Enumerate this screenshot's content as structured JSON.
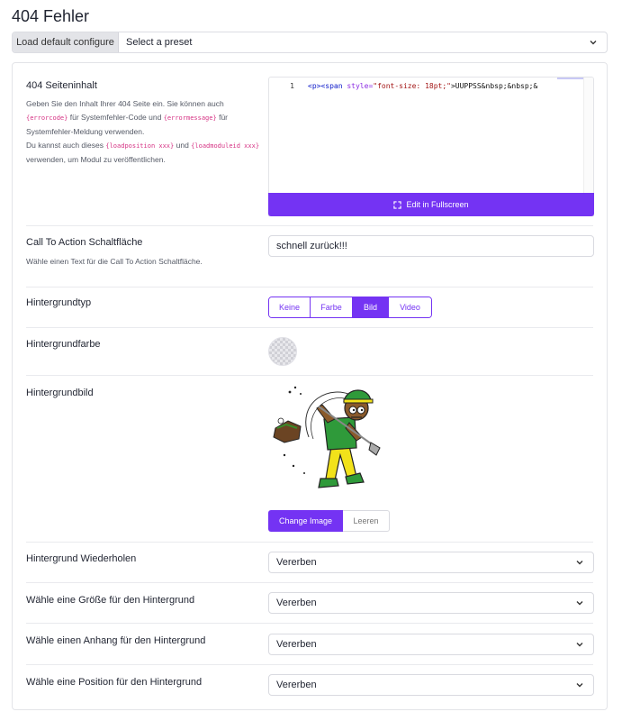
{
  "page": {
    "title": "404 Fehler"
  },
  "preset": {
    "load_default_label": "Load default configure",
    "select_placeholder": "Select a preset"
  },
  "content": {
    "label": "404 Seiteninhalt",
    "help_1": "Geben Sie den Inhalt Ihrer 404 Seite ein. Sie können auch",
    "token_errorcode": "{errorcode}",
    "help_2": "für Systemfehler-Code und",
    "token_errormessage": "{errormessage}",
    "help_3": "für Systemfehler-Meldung verwenden.",
    "help_4": "Du kannst auch dieses",
    "token_loadposition": "{loadposition xxx}",
    "help_5": "und",
    "token_loadmoduleid": "{loadmoduleid xxx}",
    "help_6": "verwenden, um Modul zu veröffentlichen.",
    "editor_line_number": "1",
    "editor_tag_open": "<p><span ",
    "editor_attr": "style=",
    "editor_str": "\"font-size: 18pt;\"",
    "editor_rest": ">UUPPSS&nbsp;&nbsp;&",
    "fullscreen_label": "Edit in Fullscreen"
  },
  "cta": {
    "label": "Call To Action Schaltfläche",
    "help": "Wähle einen Text für die Call To Action Schaltfläche.",
    "value": "schnell zurück!!!"
  },
  "bg_type": {
    "label": "Hintergrundtyp",
    "options": [
      "Keine",
      "Farbe",
      "Bild",
      "Video"
    ],
    "selected": "Bild"
  },
  "bg_color": {
    "label": "Hintergrundfarbe"
  },
  "bg_image": {
    "label": "Hintergrundbild",
    "change_label": "Change Image",
    "clear_label": "Leeren"
  },
  "bg_repeat": {
    "label": "Hintergrund Wiederholen",
    "value": "Vererben"
  },
  "bg_size": {
    "label": "Wähle eine Größe für den Hintergrund",
    "value": "Vererben"
  },
  "bg_attachment": {
    "label": "Wähle einen Anhang für den Hintergrund",
    "value": "Vererben"
  },
  "bg_position": {
    "label": "Wähle eine Position für den Hintergrund",
    "value": "Vererben"
  }
}
